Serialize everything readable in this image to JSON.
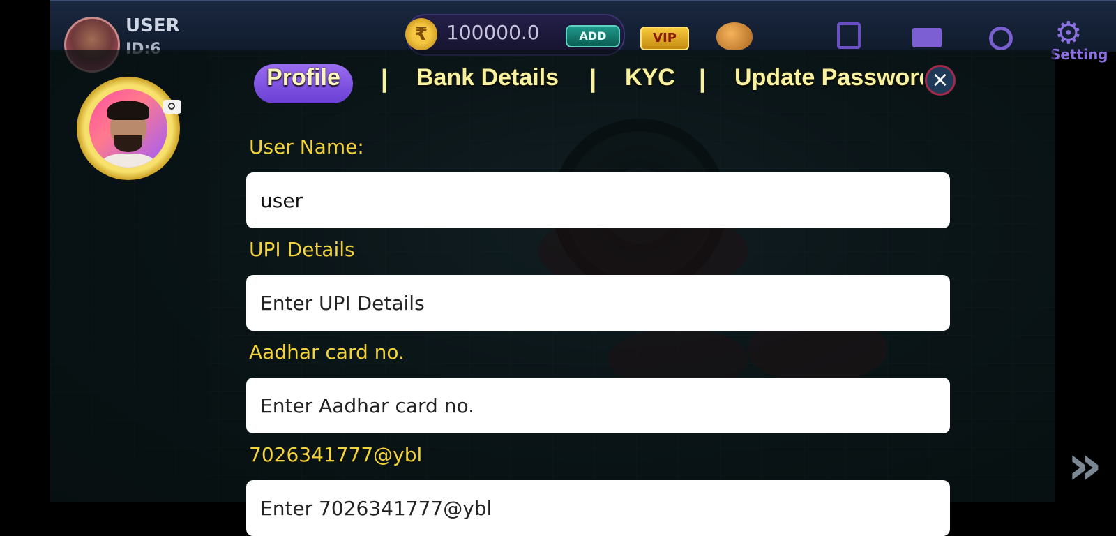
{
  "topbar": {
    "username": "USER",
    "user_id": "ID:6",
    "currency_symbol": "₹",
    "balance": "100000.0",
    "add_label": "ADD",
    "vip_label": "VIP",
    "setting_label": "Setting"
  },
  "tabs": {
    "profile": "Profile",
    "bank_details": "Bank Details",
    "kyc": "KYC",
    "update_password": "Update Password",
    "separator": "|"
  },
  "close_label": "×",
  "form": {
    "username_label": "User Name:",
    "username_value": "user",
    "upi_label": "UPI Details",
    "upi_placeholder": "Enter UPI Details",
    "aadhar_label": "Aadhar card no.",
    "aadhar_placeholder": "Enter Aadhar card no.",
    "vpa_label": "7026341777@ybl",
    "vpa_placeholder": "Enter 7026341777@ybl"
  },
  "colors": {
    "label_yellow": "#f3d23a",
    "tab_text": "#f7f1a0",
    "tab_active_bg": "#7b4fe0",
    "close_border": "#a02a4a"
  },
  "icons": [
    "rupee-coin-icon",
    "piggy-bank-icon",
    "scroll-icon",
    "mail-icon",
    "support-headset-icon",
    "gear-icon",
    "camera-icon",
    "close-icon",
    "next-arrow-icon"
  ]
}
